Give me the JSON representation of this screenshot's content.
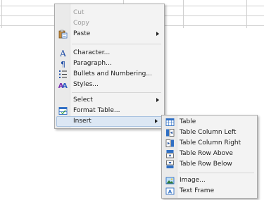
{
  "context_menu": {
    "items": [
      {
        "label": "Cut",
        "icon": "scissors-icon",
        "enabled": false
      },
      {
        "label": "Copy",
        "icon": "copy-icon",
        "enabled": false
      },
      {
        "label": "Paste",
        "icon": "paste-icon",
        "enabled": true,
        "has_submenu": true
      },
      {
        "label": "Character...",
        "icon": "character-icon",
        "enabled": true
      },
      {
        "label": "Paragraph...",
        "icon": "paragraph-icon",
        "enabled": true
      },
      {
        "label": "Bullets and Numbering...",
        "icon": "bullets-icon",
        "enabled": true
      },
      {
        "label": "Styles...",
        "icon": "styles-icon",
        "enabled": true
      },
      {
        "label": "Select",
        "icon": "",
        "enabled": true,
        "has_submenu": true
      },
      {
        "label": "Format Table...",
        "icon": "format-table-icon",
        "enabled": true
      },
      {
        "label": "Insert",
        "icon": "",
        "enabled": true,
        "has_submenu": true,
        "highlighted": true
      }
    ]
  },
  "insert_submenu": {
    "items": [
      {
        "label": "Table",
        "icon": "table-icon"
      },
      {
        "label": "Table Column Left",
        "icon": "column-left-icon"
      },
      {
        "label": "Table Column Right",
        "icon": "column-right-icon"
      },
      {
        "label": "Table Row Above",
        "icon": "row-above-icon"
      },
      {
        "label": "Table Row Below",
        "icon": "row-below-icon"
      },
      {
        "label": "Image...",
        "icon": "image-icon"
      },
      {
        "label": "Text Frame",
        "icon": "text-frame-icon"
      }
    ]
  },
  "colors": {
    "menu_background": "#f3f3f3",
    "highlight": "#dce7f4",
    "icon_blue": "#2f6fc4"
  }
}
